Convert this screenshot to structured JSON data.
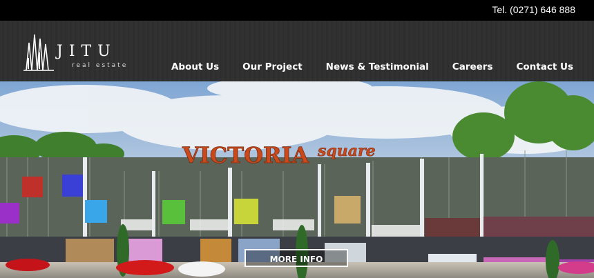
{
  "topbar": {
    "phone": "Tel. (0271) 646 888"
  },
  "brand": {
    "name": "JITU",
    "tagline": "real estate",
    "icon": "building-logo-icon"
  },
  "nav": {
    "items": [
      {
        "label": "About Us"
      },
      {
        "label": "Our Project"
      },
      {
        "label": "News & Testimonial"
      },
      {
        "label": "Careers"
      },
      {
        "label": "Contact Us"
      }
    ]
  },
  "hero": {
    "sign_main": "VICTORIA",
    "sign_sub": "square",
    "button_label": "MORE INFO"
  },
  "colors": {
    "topbar": "#000000",
    "header": "#303030",
    "sign": "#c84a1c",
    "facade": "#5a635a"
  }
}
